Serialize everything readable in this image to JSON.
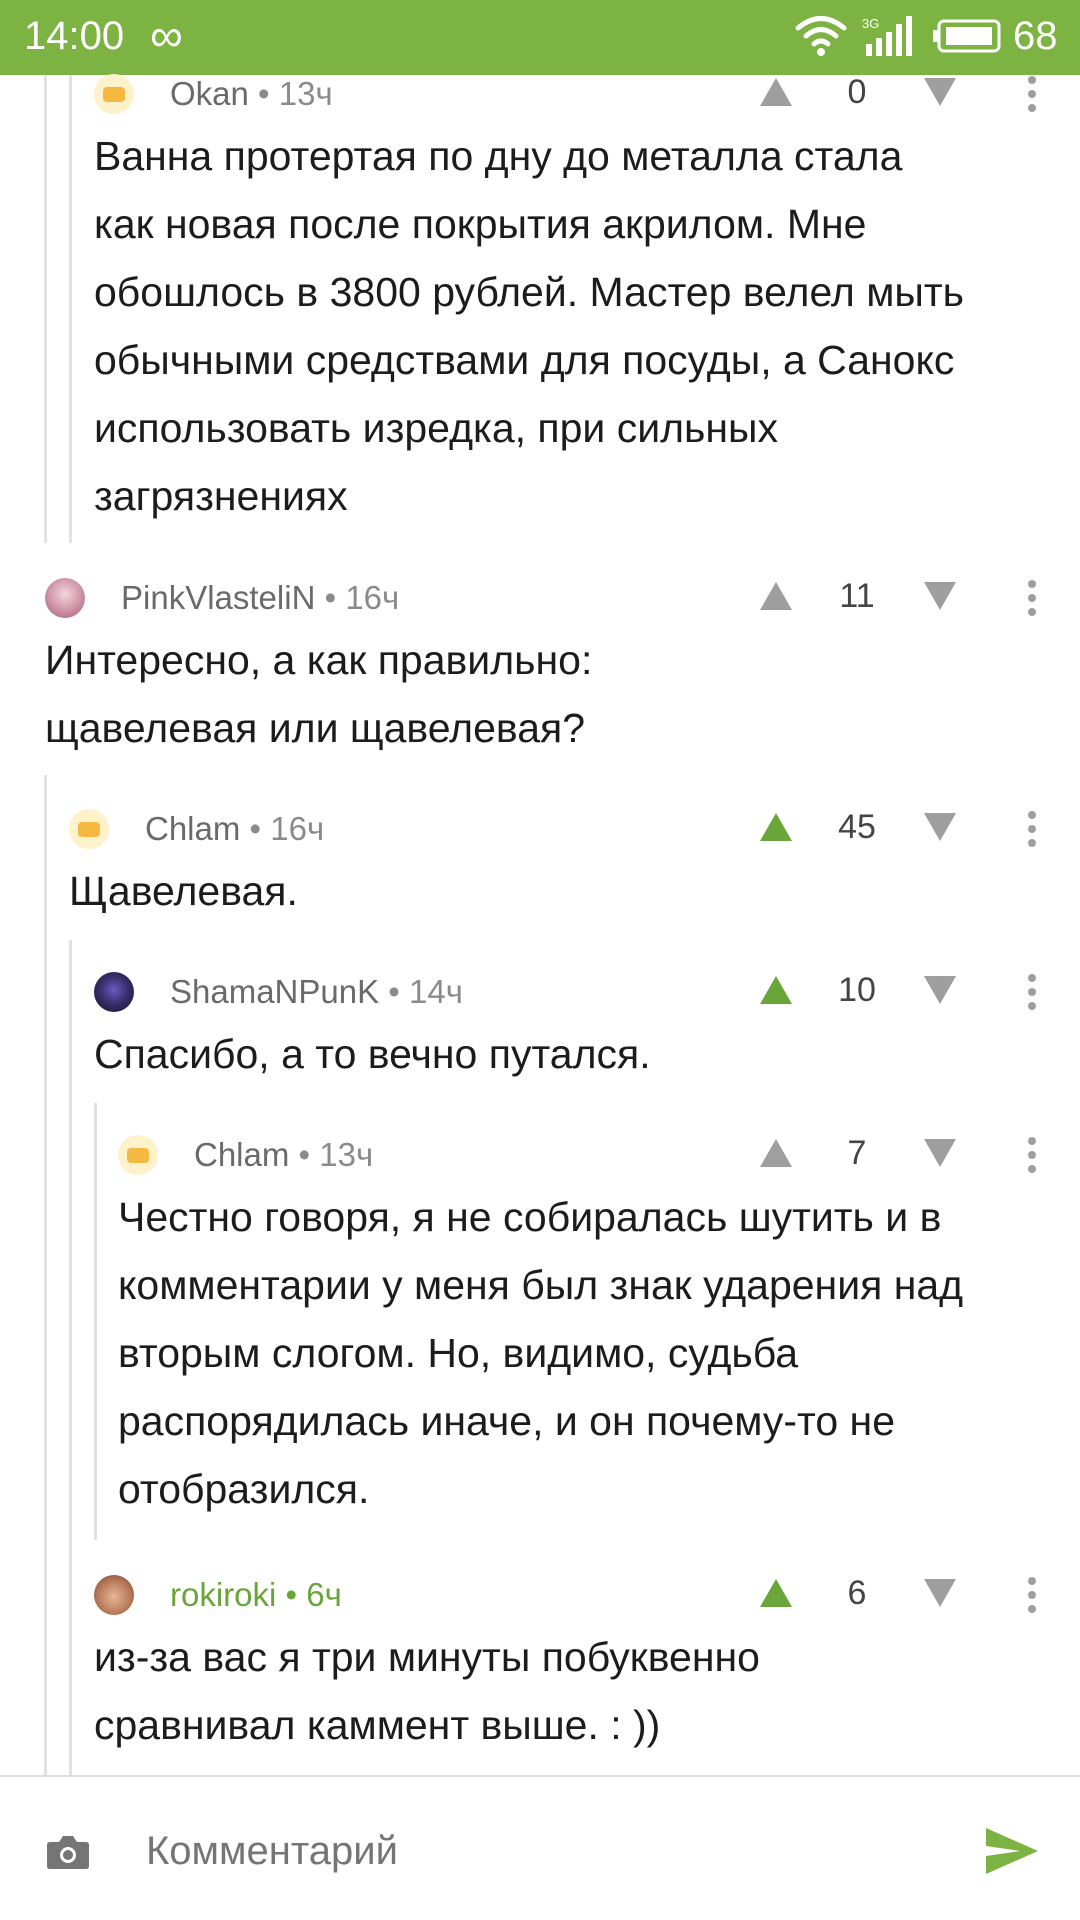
{
  "status_bar": {
    "time": "14:00",
    "infinity_icon": "∞",
    "network_label": "3G",
    "battery": "68"
  },
  "comments": [
    {
      "author": "Okan",
      "time": "13ч",
      "score": "0",
      "upvoted": false,
      "lines": [
        "Ванна протертая по дну до металла стала",
        "как новая после покрытия акрилом. Мне",
        "обошлось в 3800 рублей. Мастер велел мыть",
        "обычными средствами для посуды, а Санокс",
        "использовать изредка, при сильных",
        "загрязнениях"
      ]
    },
    {
      "author": "PinkVlasteliN",
      "time": "16ч",
      "score": "11",
      "upvoted": false,
      "lines": [
        "Интересно, а как правильно:",
        "щавелевая или щавелевая?"
      ]
    },
    {
      "author": "Chlam",
      "time": "16ч",
      "score": "45",
      "upvoted": true,
      "lines": [
        "Щавелевая."
      ]
    },
    {
      "author": "ShamaNPunK",
      "time": "14ч",
      "score": "10",
      "upvoted": true,
      "lines": [
        "Спасибо, а то вечно путался."
      ]
    },
    {
      "author": "Chlam",
      "time": "13ч",
      "score": "7",
      "upvoted": false,
      "lines": [
        "Честно говоря, я не собиралась шутить и в",
        "комментарии у меня был знак ударения над",
        "вторым слогом. Но, видимо, судьба",
        "распорядилась иначе, и он почему-то не",
        "отобразился."
      ]
    },
    {
      "author": "rokiroki",
      "time": "6ч",
      "score": "6",
      "upvoted": true,
      "lines": [
        "из-за вас я три минуты побуквенно",
        "сравнивал каммент выше.  : ))"
      ]
    }
  ],
  "meta_separator": " • ",
  "bottom_bar": {
    "placeholder": "Комментарий"
  },
  "colors": {
    "accent": "#7cb342",
    "upvote_active": "#6aa539",
    "inactive_icon": "#9e9e9e"
  }
}
